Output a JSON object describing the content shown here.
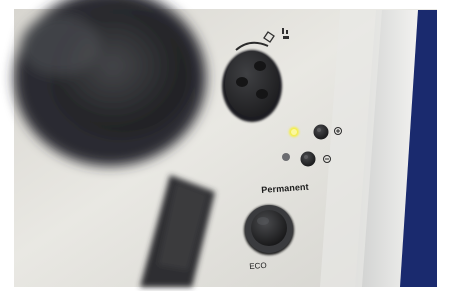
{
  "photo": {
    "subject": "microscope-control-panel",
    "labels": {
      "permanent": "Permanent",
      "eco": "ECO"
    },
    "icons": [
      "lamp-icon",
      "light-intensity-icon",
      "plus-button-icon",
      "minus-button-icon"
    ],
    "colors": {
      "panel": "#e4e3dd",
      "panel_shadow": "#b9b8b2",
      "knob": "#2b2c2e",
      "led_yellow": "#f2ec3a",
      "accent_blue": "#1a2a6e"
    }
  }
}
